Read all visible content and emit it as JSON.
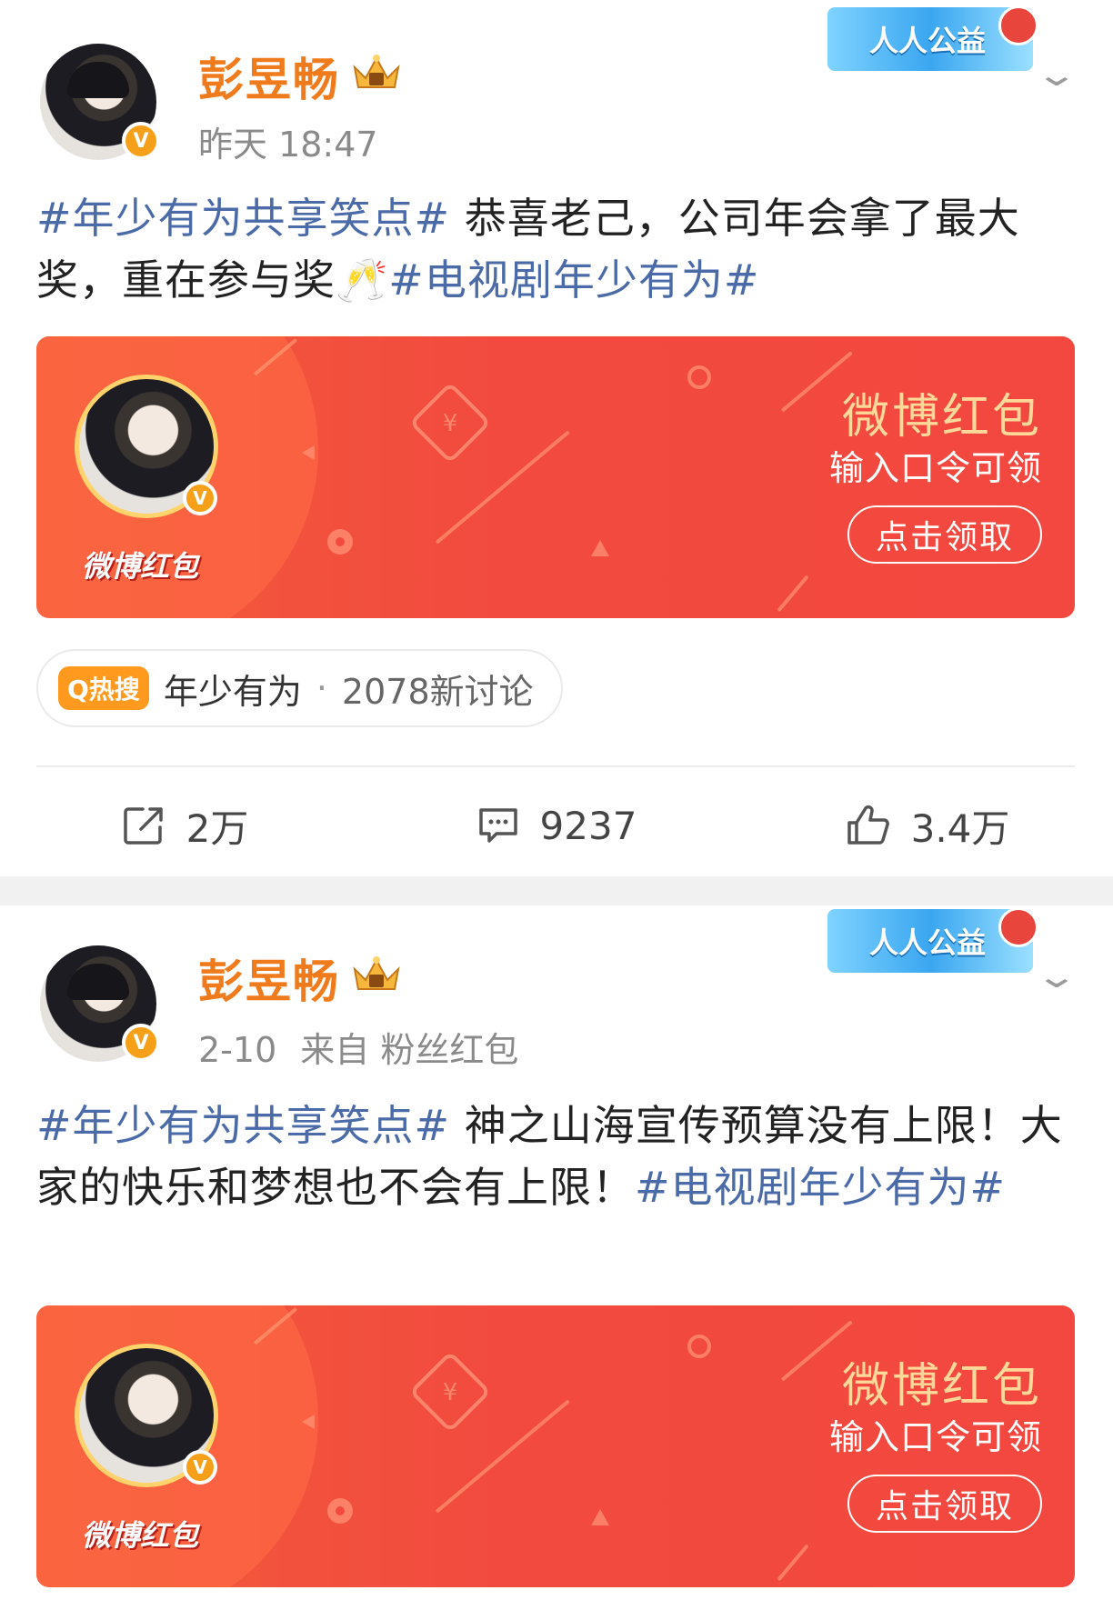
{
  "posts": [
    {
      "username": "彭昱畅",
      "meta": {
        "time": "昨天 18:47",
        "source": ""
      },
      "promo_label": "人人公益",
      "text": {
        "topic1": "#年少有为共享笑点#",
        "body": " 恭喜老己，公司年会拿了最大奖，重在参与奖🥂",
        "topic2": "#电视剧年少有为#"
      },
      "redpack": {
        "logo": "微博红包",
        "title": "微博红包",
        "subtitle": "输入口令可领",
        "button": "点击领取"
      },
      "hot": {
        "tag": "Q热搜",
        "topic": "年少有为",
        "separator": "·",
        "count": "2078新讨论"
      },
      "actions": {
        "repost": "2万",
        "comment": "9237",
        "like": "3.4万"
      }
    },
    {
      "username": "彭昱畅",
      "meta": {
        "time": "2-10",
        "source": "来自 粉丝红包"
      },
      "promo_label": "人人公益",
      "text": {
        "topic1": "#年少有为共享笑点#",
        "body": " 神之山海宣传预算没有上限！大家的快乐和梦想也不会有上限！",
        "topic2": "#电视剧年少有为#"
      },
      "redpack": {
        "logo": "微博红包",
        "title": "微博红包",
        "subtitle": "输入口令可领",
        "button": "点击领取"
      }
    }
  ],
  "icons": {
    "verified": "verified-v-badge",
    "member": "crown-member-badge",
    "more": "chevron-down-icon",
    "repost": "repost-icon",
    "comment": "comment-icon",
    "like": "like-thumb-icon"
  },
  "colors": {
    "username": "#f07b1d",
    "topic": "#4a6aa8",
    "redpack": "#f24a3f",
    "redpack_title": "#ffd89a",
    "hot_tag": "#ff9a1f"
  }
}
